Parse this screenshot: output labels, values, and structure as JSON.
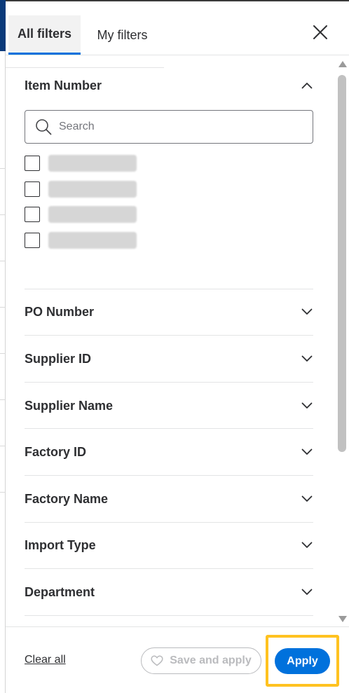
{
  "tabs": [
    {
      "label": "All filters",
      "active": true
    },
    {
      "label": "My filters",
      "active": false
    }
  ],
  "close_icon": "close-icon",
  "sections": [
    {
      "title": "Item Number",
      "expanded": true
    },
    {
      "title": "PO Number",
      "expanded": false
    },
    {
      "title": "Supplier ID",
      "expanded": false
    },
    {
      "title": "Supplier Name",
      "expanded": false
    },
    {
      "title": "Factory ID",
      "expanded": false
    },
    {
      "title": "Factory Name",
      "expanded": false
    },
    {
      "title": "Import Type",
      "expanded": false
    },
    {
      "title": "Department",
      "expanded": false
    }
  ],
  "search": {
    "placeholder": "Search",
    "value": ""
  },
  "footer": {
    "clear_label": "Clear all",
    "save_apply_label": "Save and apply",
    "apply_label": "Apply"
  },
  "colors": {
    "accent": "#0071dc",
    "highlight": "#ffc220",
    "text": "#2e2f32",
    "muted": "#babbbe"
  }
}
